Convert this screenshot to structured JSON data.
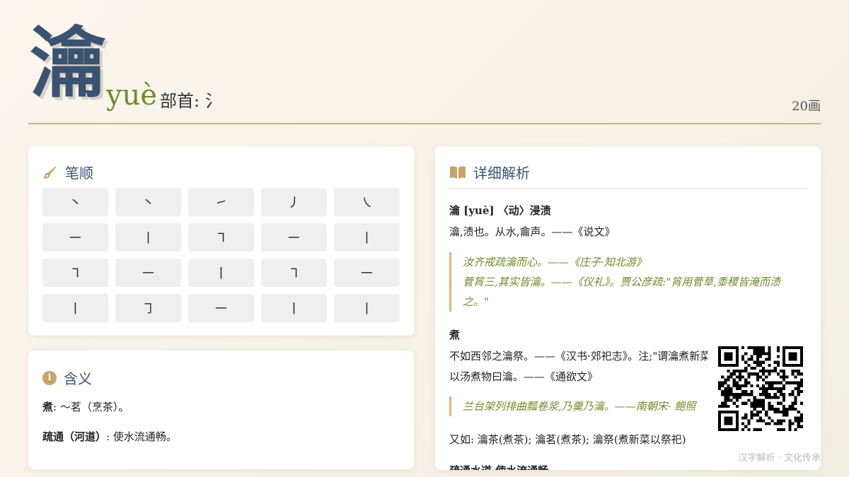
{
  "character": "瀹",
  "pinyin": "yuè",
  "radical_label": "部首: 氵",
  "stroke_count": "20画",
  "stroke_order": {
    "title": "笔顺",
    "strokes": [
      "丶",
      "丶",
      "㇀",
      "丿",
      "㇏",
      "㇐",
      "丨",
      "㇕",
      "㇐",
      "丨",
      "㇕",
      "㇐",
      "丨",
      "㇕",
      "㇐",
      "丨",
      "㇆",
      "㇐",
      "丨",
      "丨"
    ]
  },
  "meaning": {
    "title": "含义",
    "items": [
      {
        "term": "煮",
        "sep": ": ",
        "text": "～茗（烹茶）。"
      },
      {
        "term": "疏通（河道）",
        "sep": ": ",
        "text": "使水流通畅。"
      }
    ]
  },
  "detail": {
    "title": "详细解析",
    "heading1": "瀹 [yuè] 〈动〉浸渍",
    "line1": "瀹,渍也。从水,龠声。——《说文》",
    "quote1": [
      "汝齐戒疏瀹而心。——《庄子·知北游》",
      "菅筲三,其实皆瀹。——《仪礼》。贾公彦疏:\"筲用菅草,黍稷皆淹而渍",
      "之。\""
    ],
    "heading2": "煮",
    "line2": "不如西邻之瀹祭。——《汉书·郊祀志》。注;\"谓瀹煮新菜以祭\"",
    "line3": "以汤煮物曰瀹。——《通欲文》",
    "quote2": "兰台架列排曲瓢卷浆,乃羹乃瀹。——南朝宋· 鲍照",
    "line4": "又如: 瀹茶(煮茶); 瀹茗(煮茶); 瀹祭(煮新菜以祭祀)",
    "heading3": "疏通水道,使水流通畅"
  },
  "footer": "汉字解析 · 文化传承",
  "colors": {
    "accent": "#3b5272",
    "green": "#6e8b2a",
    "gold": "#c9a269"
  }
}
